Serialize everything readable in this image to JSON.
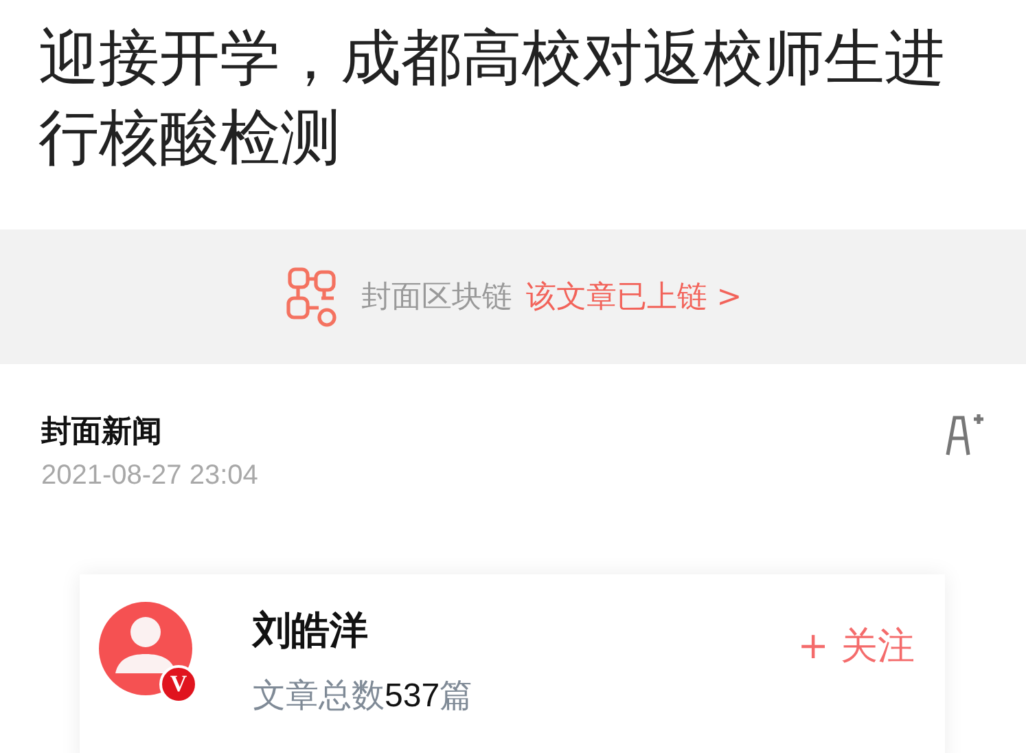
{
  "headline": "迎接开学，成都高校对返校师生进行核酸检测",
  "blockchain_banner": {
    "label": "封面区块链",
    "link": "该文章已上链 >"
  },
  "source": "封面新闻",
  "published": "2021-08-27 23:04",
  "author_card": {
    "name": "刘皓洋",
    "verified": true,
    "badge": "V",
    "count_label": "文章总数",
    "count": "537",
    "count_unit": "篇",
    "follow": "+ 关注"
  }
}
